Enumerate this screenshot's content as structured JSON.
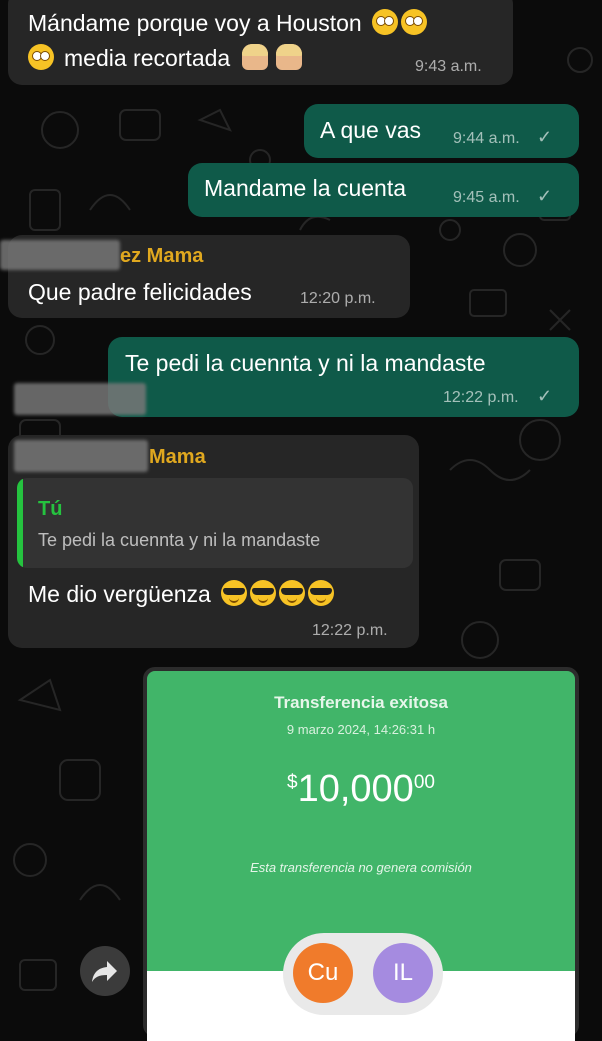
{
  "messages": [
    {
      "text": "Mándame porque voy a Houston",
      "line2": "media recortada",
      "time": "9:43 a.m."
    },
    {
      "text": "A que vas",
      "time": "9:44 a.m.",
      "status": "✓"
    },
    {
      "text": "Mandame la cuenta",
      "time": "9:45 a.m.",
      "status": "✓"
    },
    {
      "sender": "ez Mama",
      "text": "Que padre felicidades",
      "time": "12:20 p.m."
    },
    {
      "text": "Te pedi la cuennta y ni la mandaste",
      "time": "12:22 p.m.",
      "status": "✓"
    },
    {
      "sender": "Mama",
      "quote_author": "Tú",
      "quote_text": "Te pedi la cuennta y ni la mandaste",
      "text": "Me dio vergüenza",
      "time": "12:22 p.m."
    }
  ],
  "receipt": {
    "title": "Transferencia exitosa",
    "date": "9 marzo 2024, 14:26:31 h",
    "amount_currency": "$",
    "amount_whole": "10,000",
    "amount_cents": "00",
    "note": "Esta transferencia no genera comisión",
    "avatar_from": "Cu",
    "avatar_to": "IL",
    "avatar_from_color": "#f07b2b",
    "avatar_to_color": "#a58be0"
  },
  "colors": {
    "background": "#0b0b0b",
    "incoming_bubble": "#262626",
    "outgoing_bubble": "#0f5a49",
    "sender_name": "#e0a81f",
    "receipt_green": "#41b569"
  },
  "icons": [
    "flushed-face-icon",
    "facepalm-icon",
    "sunglasses-face-icon",
    "check-icon",
    "forward-icon"
  ]
}
